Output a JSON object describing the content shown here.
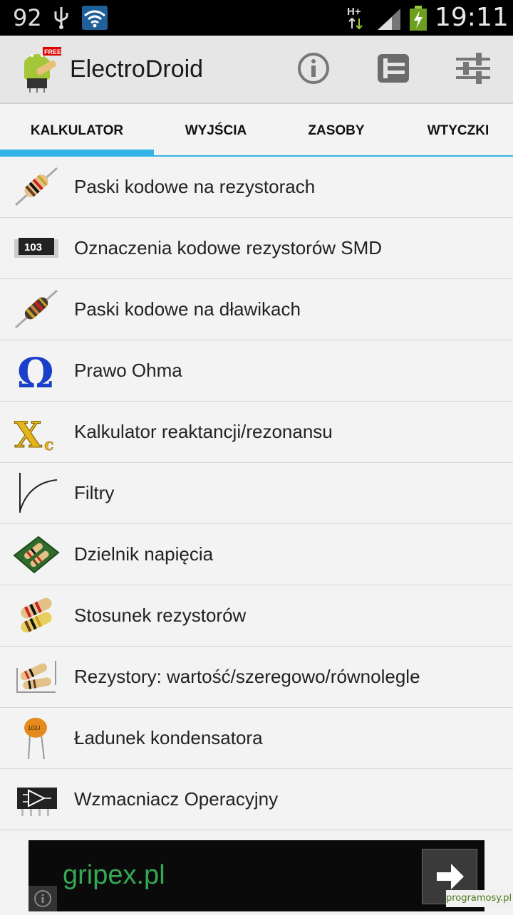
{
  "status_bar": {
    "battery_level": "92",
    "network": "H+",
    "time": "19:11",
    "icons": [
      "usb-icon",
      "wifi-icon",
      "mobile-data-icon",
      "signal-icon",
      "battery-charging-icon"
    ]
  },
  "app": {
    "title": "ElectroDroid",
    "icon_badge": "FREE"
  },
  "actions": {
    "icons": [
      "info-icon",
      "plug-icon",
      "settings-sliders-icon"
    ]
  },
  "tabs": [
    {
      "label": "KALKULATOR",
      "selected": true
    },
    {
      "label": "WYJŚCIA"
    },
    {
      "label": "ZASOBY"
    },
    {
      "label": "WTYCZKI"
    }
  ],
  "items": [
    {
      "label": "Paski kodowe na rezystorach",
      "icon": "resistor-icon"
    },
    {
      "label": "Oznaczenia kodowe rezystorów SMD",
      "icon": "smd-resistor-icon",
      "icon_text": "103"
    },
    {
      "label": "Paski kodowe na dławikach",
      "icon": "inductor-icon"
    },
    {
      "label": "Prawo Ohma",
      "icon": "omega-icon",
      "icon_text": "Ω"
    },
    {
      "label": "Kalkulator reaktancji/rezonansu",
      "icon": "reactance-icon",
      "icon_text": "X",
      "icon_sub": "c"
    },
    {
      "label": "Filtry",
      "icon": "filter-curve-icon"
    },
    {
      "label": "Dzielnik napięcia",
      "icon": "voltage-divider-icon"
    },
    {
      "label": "Stosunek rezystorów",
      "icon": "resistor-ratio-icon"
    },
    {
      "label": "Rezystory: wartość/szeregowo/równolegle",
      "icon": "resistor-network-icon"
    },
    {
      "label": "Ładunek kondensatora",
      "icon": "capacitor-icon",
      "icon_text": "103J"
    },
    {
      "label": "Wzmacniacz Operacyjny",
      "icon": "op-amp-icon"
    }
  ],
  "ad": {
    "text": "gripex.pl"
  },
  "watermark": "programosy.pl",
  "colors": {
    "accent": "#33b5e5",
    "ad_text": "#34a853",
    "background": "#f3f3f3"
  }
}
